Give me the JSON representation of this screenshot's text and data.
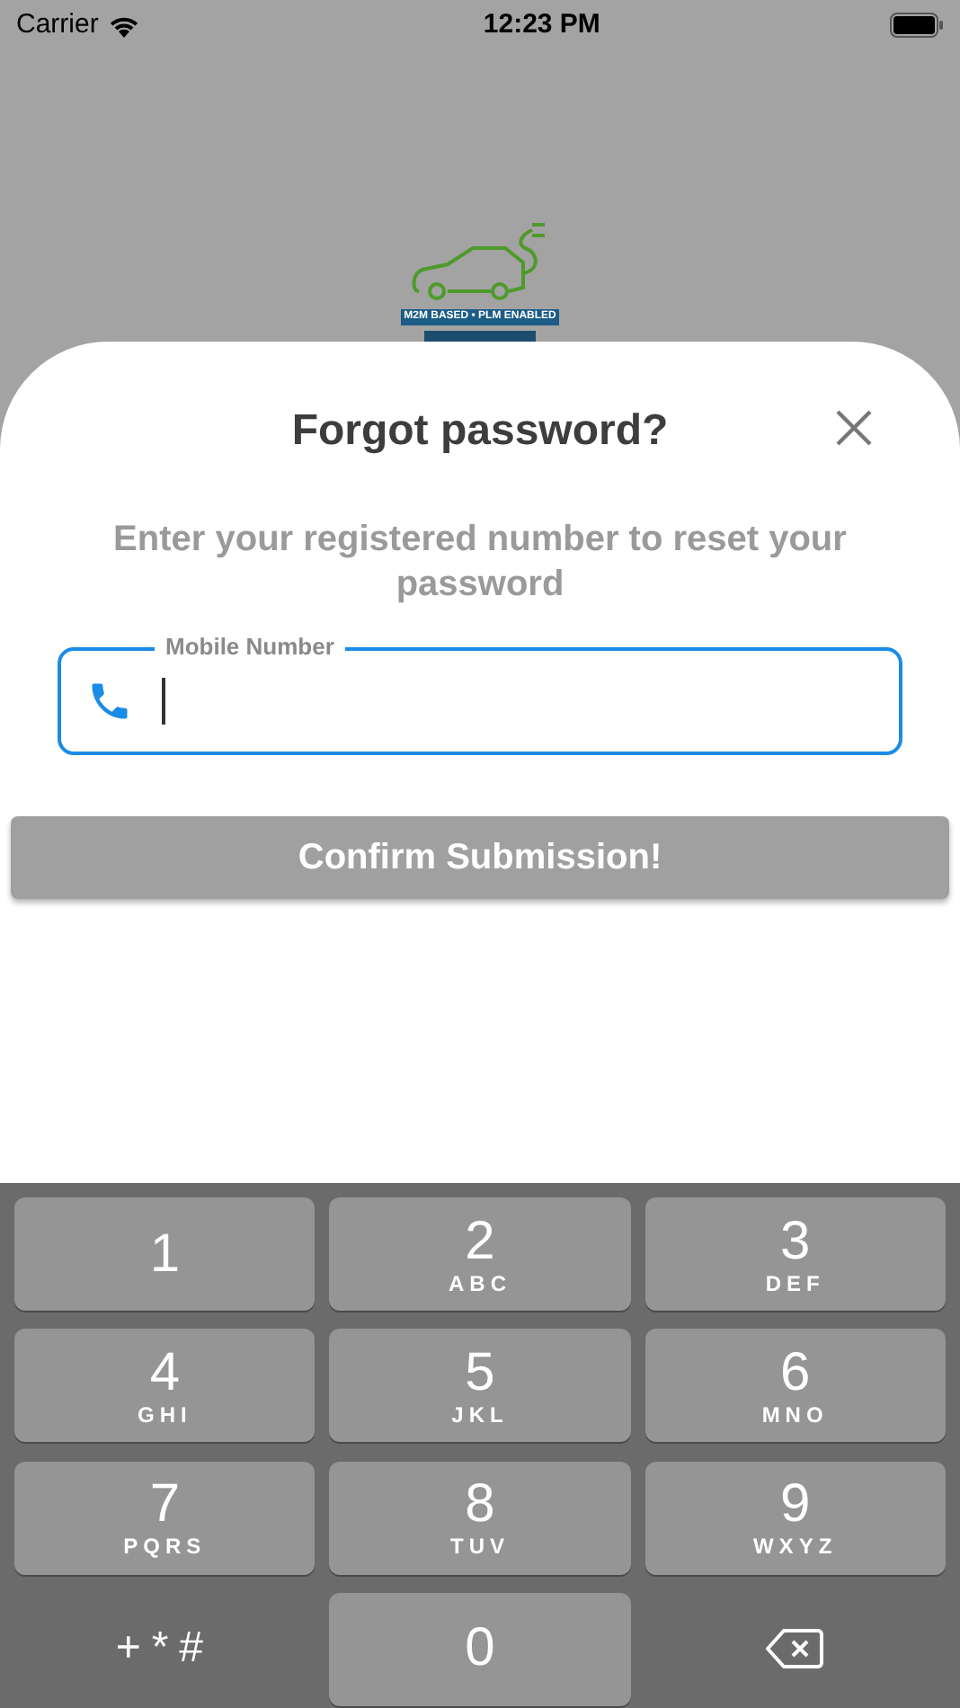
{
  "status_bar": {
    "carrier": "Carrier",
    "time": "12:23 PM"
  },
  "logo": {
    "tagline": "M2M BASED • PLM ENABLED"
  },
  "sheet": {
    "title": "Forgot password?",
    "subtitle": "Enter your registered number to reset your password",
    "field": {
      "label": "Mobile Number",
      "focused": true
    },
    "button": "Confirm Submission!"
  },
  "keypad": [
    {
      "kind": "digit",
      "digit": "1"
    },
    {
      "kind": "digit",
      "digit": "2",
      "letters": "ABC"
    },
    {
      "kind": "digit",
      "digit": "3",
      "letters": "DEF"
    },
    {
      "kind": "digit",
      "digit": "4",
      "letters": "GHI"
    },
    {
      "kind": "digit",
      "digit": "5",
      "letters": "JKL"
    },
    {
      "kind": "digit",
      "digit": "6",
      "letters": "MNO"
    },
    {
      "kind": "digit",
      "digit": "7",
      "letters": "PQRS"
    },
    {
      "kind": "digit",
      "digit": "8",
      "letters": "TUV"
    },
    {
      "kind": "digit",
      "digit": "9",
      "letters": "WXYZ"
    },
    {
      "kind": "symbols",
      "digit": "+*#"
    },
    {
      "kind": "digit",
      "digit": "0"
    },
    {
      "kind": "delete"
    }
  ]
}
